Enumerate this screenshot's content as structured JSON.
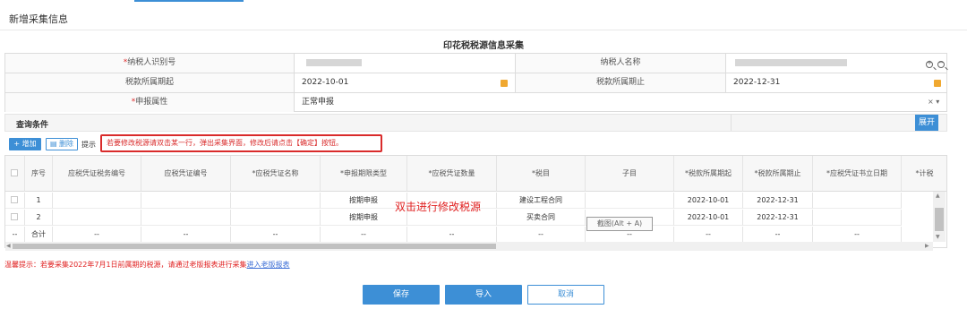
{
  "page": {
    "title": "新增采集信息"
  },
  "form": {
    "title": "印花税税源信息采集",
    "taxpayer_id_label": "纳税人识别号",
    "taxpayer_name_label": "纳税人名称",
    "period_start_label": "税款所属期起",
    "period_start_value": "2022-10-01",
    "period_end_label": "税款所属期止",
    "period_end_value": "2022-12-31",
    "declare_attr_label": "申报属性",
    "declare_attr_value": "正常申报",
    "clear_symbol": "× ▾",
    "zoom_in": "+",
    "zoom_out": "−"
  },
  "query": {
    "label": "查询条件",
    "expand": "展开"
  },
  "toolbar": {
    "add": "+ 增加",
    "delete": "▤ 删除",
    "tip_label": "提示",
    "tip_text": "若要修改税源请双击某一行，弹出采集界面，修改后请点击【确定】按钮。"
  },
  "table": {
    "columns": [
      "序号",
      "应税凭证税务编号",
      "应税凭证编号",
      "*应税凭证名称",
      "*申报期限类型",
      "*应税凭证数量",
      "*税目",
      "子目",
      "*税款所属期起",
      "*税款所属期止",
      "*应税凭证书立日期",
      "*计税"
    ],
    "rows": [
      {
        "no": "1",
        "period_type": "按期申报",
        "item": "建设工程合同",
        "start": "2022-10-01",
        "end": "2022-12-31"
      },
      {
        "no": "2",
        "period_type": "按期申报",
        "item": "买卖合同",
        "start": "2022-10-01",
        "end": "2022-12-31"
      }
    ],
    "total_label": "合计",
    "dash": "--"
  },
  "overlay": {
    "text": "双击进行修改税源",
    "screenshot_tip": "截图(Alt + A)"
  },
  "notice": {
    "text": "温馨提示：若要采集2022年7月1日前属期的税源，请通过老版报表进行采集",
    "link": "进入老版报表"
  },
  "buttons": {
    "save": "保存",
    "import": "导入",
    "cancel": "取消"
  },
  "colors": {
    "accent": "#3d8fd6",
    "alert": "#e02020"
  }
}
